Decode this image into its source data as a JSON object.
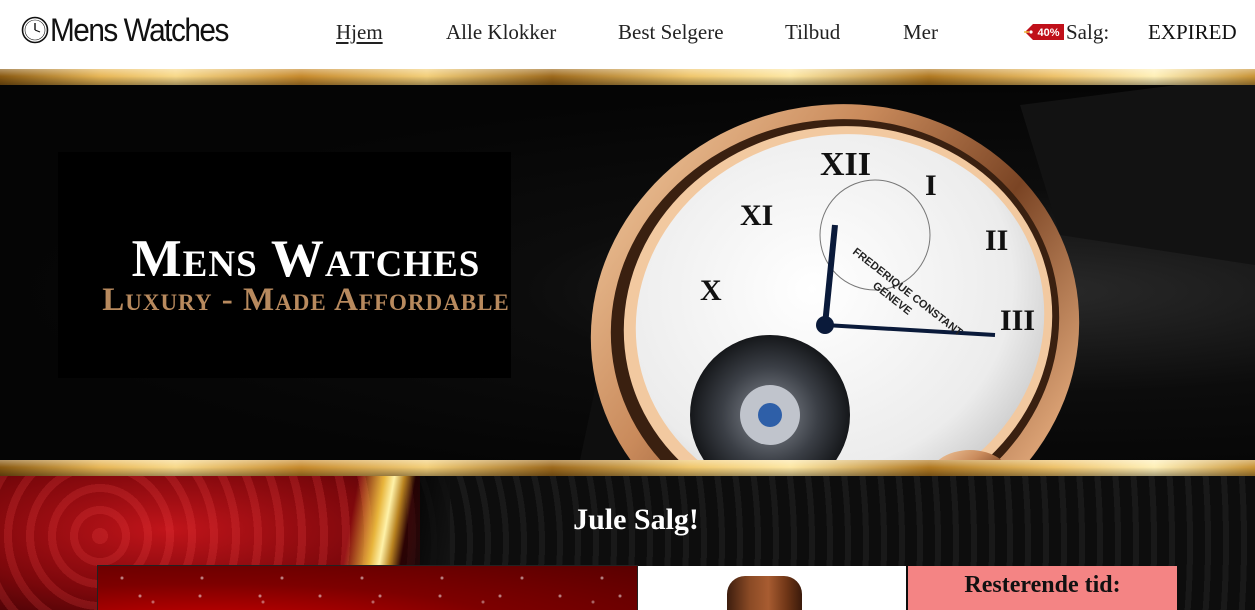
{
  "header": {
    "logo_text": "Mens Watches",
    "nav": [
      {
        "label": "Hjem",
        "active": true
      },
      {
        "label": "Alle Klokker"
      },
      {
        "label": "Best Selgere"
      },
      {
        "label": "Tilbud"
      },
      {
        "label": "Mer"
      }
    ],
    "sale_badge": "40%",
    "sale_label": "Salg:",
    "countdown_status": "EXPIRED"
  },
  "hero": {
    "title": "Mens Watches",
    "subtitle": "Luxury - Made Affordable",
    "watch_brand": "FREDERIQUE CONSTANT",
    "watch_city": "GENEVE"
  },
  "promo": {
    "heading": "Jule Salg!",
    "countdown_label": "Resterende tid:"
  },
  "colors": {
    "sale_badge": "#c0101a",
    "hero_subtitle": "#b88a5e",
    "countdown_card": "#f48484",
    "gold": "#e7b656"
  }
}
